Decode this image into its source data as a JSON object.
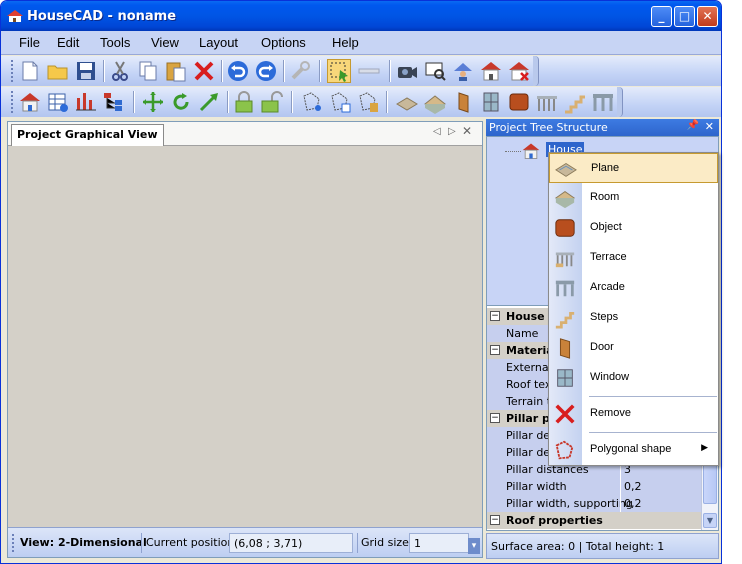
{
  "window": {
    "title": "HouseCAD - noname"
  },
  "menu": [
    "File",
    "Edit",
    "Tools",
    "View",
    "Layout",
    "Options",
    "Help"
  ],
  "left_pane": {
    "tab_label": "Project Graphical View"
  },
  "statusbar": {
    "view": "View: 2-Dimensional",
    "position_label": "Current position:",
    "position_value": "(6,08 ; 3,71)",
    "grid_label": "Grid size:",
    "grid_value": "1"
  },
  "tree": {
    "header": "Project Tree Structure",
    "node_label": "House"
  },
  "properties": {
    "rows": [
      {
        "type": "cat",
        "label": "House p",
        "value": ""
      },
      {
        "type": "item",
        "label": "Name",
        "value": ""
      },
      {
        "type": "cat",
        "label": "Materia",
        "value": ""
      },
      {
        "type": "item",
        "label": "External",
        "value": ""
      },
      {
        "type": "item",
        "label": "Roof tex",
        "value": ""
      },
      {
        "type": "item",
        "label": "Terrain t",
        "value": ""
      },
      {
        "type": "cat",
        "label": "Pillar pr",
        "value": ""
      },
      {
        "type": "item",
        "label": "Pillar dep",
        "value": ""
      },
      {
        "type": "item",
        "label": "Pillar dep",
        "value": ""
      },
      {
        "type": "item",
        "label": "Pillar distances",
        "value": "3"
      },
      {
        "type": "item",
        "label": "Pillar width",
        "value": "0,2"
      },
      {
        "type": "item",
        "label": "Pillar width, supporting",
        "value": "0,2"
      },
      {
        "type": "cat",
        "label": "Roof properties",
        "value": ""
      }
    ],
    "status": "Surface area: 0  |  Total height: 1"
  },
  "context_menu": {
    "items": [
      {
        "label": "Plane",
        "icon": "plane-icon",
        "highlighted": true
      },
      {
        "label": "Room",
        "icon": "room-icon"
      },
      {
        "label": "Object",
        "icon": "object-icon"
      },
      {
        "label": "Terrace",
        "icon": "terrace-icon"
      },
      {
        "label": "Arcade",
        "icon": "arcade-icon"
      },
      {
        "label": "Steps",
        "icon": "steps-icon"
      },
      {
        "label": "Door",
        "icon": "door-icon"
      },
      {
        "label": "Window",
        "icon": "window-icon"
      },
      {
        "label": "Remove",
        "icon": "remove-icon"
      },
      {
        "label": "Polygonal shape",
        "icon": "polygon-icon",
        "submenu": true
      }
    ]
  },
  "colors": {
    "titlebar": "#0055E5",
    "menubar": "#C7D4F4",
    "highlight": "#FBEBC6",
    "tree_selection": "#2E65CC"
  }
}
